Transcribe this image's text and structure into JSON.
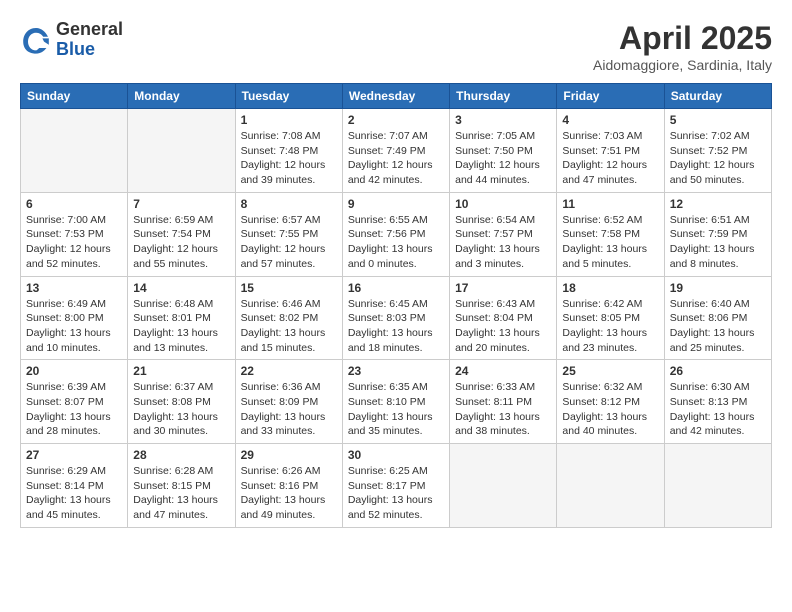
{
  "header": {
    "logo_general": "General",
    "logo_blue": "Blue",
    "month_title": "April 2025",
    "location": "Aidomaggiore, Sardinia, Italy"
  },
  "weekdays": [
    "Sunday",
    "Monday",
    "Tuesday",
    "Wednesday",
    "Thursday",
    "Friday",
    "Saturday"
  ],
  "weeks": [
    [
      {
        "day": "",
        "info": ""
      },
      {
        "day": "",
        "info": ""
      },
      {
        "day": "1",
        "info": "Sunrise: 7:08 AM\nSunset: 7:48 PM\nDaylight: 12 hours\nand 39 minutes."
      },
      {
        "day": "2",
        "info": "Sunrise: 7:07 AM\nSunset: 7:49 PM\nDaylight: 12 hours\nand 42 minutes."
      },
      {
        "day": "3",
        "info": "Sunrise: 7:05 AM\nSunset: 7:50 PM\nDaylight: 12 hours\nand 44 minutes."
      },
      {
        "day": "4",
        "info": "Sunrise: 7:03 AM\nSunset: 7:51 PM\nDaylight: 12 hours\nand 47 minutes."
      },
      {
        "day": "5",
        "info": "Sunrise: 7:02 AM\nSunset: 7:52 PM\nDaylight: 12 hours\nand 50 minutes."
      }
    ],
    [
      {
        "day": "6",
        "info": "Sunrise: 7:00 AM\nSunset: 7:53 PM\nDaylight: 12 hours\nand 52 minutes."
      },
      {
        "day": "7",
        "info": "Sunrise: 6:59 AM\nSunset: 7:54 PM\nDaylight: 12 hours\nand 55 minutes."
      },
      {
        "day": "8",
        "info": "Sunrise: 6:57 AM\nSunset: 7:55 PM\nDaylight: 12 hours\nand 57 minutes."
      },
      {
        "day": "9",
        "info": "Sunrise: 6:55 AM\nSunset: 7:56 PM\nDaylight: 13 hours\nand 0 minutes."
      },
      {
        "day": "10",
        "info": "Sunrise: 6:54 AM\nSunset: 7:57 PM\nDaylight: 13 hours\nand 3 minutes."
      },
      {
        "day": "11",
        "info": "Sunrise: 6:52 AM\nSunset: 7:58 PM\nDaylight: 13 hours\nand 5 minutes."
      },
      {
        "day": "12",
        "info": "Sunrise: 6:51 AM\nSunset: 7:59 PM\nDaylight: 13 hours\nand 8 minutes."
      }
    ],
    [
      {
        "day": "13",
        "info": "Sunrise: 6:49 AM\nSunset: 8:00 PM\nDaylight: 13 hours\nand 10 minutes."
      },
      {
        "day": "14",
        "info": "Sunrise: 6:48 AM\nSunset: 8:01 PM\nDaylight: 13 hours\nand 13 minutes."
      },
      {
        "day": "15",
        "info": "Sunrise: 6:46 AM\nSunset: 8:02 PM\nDaylight: 13 hours\nand 15 minutes."
      },
      {
        "day": "16",
        "info": "Sunrise: 6:45 AM\nSunset: 8:03 PM\nDaylight: 13 hours\nand 18 minutes."
      },
      {
        "day": "17",
        "info": "Sunrise: 6:43 AM\nSunset: 8:04 PM\nDaylight: 13 hours\nand 20 minutes."
      },
      {
        "day": "18",
        "info": "Sunrise: 6:42 AM\nSunset: 8:05 PM\nDaylight: 13 hours\nand 23 minutes."
      },
      {
        "day": "19",
        "info": "Sunrise: 6:40 AM\nSunset: 8:06 PM\nDaylight: 13 hours\nand 25 minutes."
      }
    ],
    [
      {
        "day": "20",
        "info": "Sunrise: 6:39 AM\nSunset: 8:07 PM\nDaylight: 13 hours\nand 28 minutes."
      },
      {
        "day": "21",
        "info": "Sunrise: 6:37 AM\nSunset: 8:08 PM\nDaylight: 13 hours\nand 30 minutes."
      },
      {
        "day": "22",
        "info": "Sunrise: 6:36 AM\nSunset: 8:09 PM\nDaylight: 13 hours\nand 33 minutes."
      },
      {
        "day": "23",
        "info": "Sunrise: 6:35 AM\nSunset: 8:10 PM\nDaylight: 13 hours\nand 35 minutes."
      },
      {
        "day": "24",
        "info": "Sunrise: 6:33 AM\nSunset: 8:11 PM\nDaylight: 13 hours\nand 38 minutes."
      },
      {
        "day": "25",
        "info": "Sunrise: 6:32 AM\nSunset: 8:12 PM\nDaylight: 13 hours\nand 40 minutes."
      },
      {
        "day": "26",
        "info": "Sunrise: 6:30 AM\nSunset: 8:13 PM\nDaylight: 13 hours\nand 42 minutes."
      }
    ],
    [
      {
        "day": "27",
        "info": "Sunrise: 6:29 AM\nSunset: 8:14 PM\nDaylight: 13 hours\nand 45 minutes."
      },
      {
        "day": "28",
        "info": "Sunrise: 6:28 AM\nSunset: 8:15 PM\nDaylight: 13 hours\nand 47 minutes."
      },
      {
        "day": "29",
        "info": "Sunrise: 6:26 AM\nSunset: 8:16 PM\nDaylight: 13 hours\nand 49 minutes."
      },
      {
        "day": "30",
        "info": "Sunrise: 6:25 AM\nSunset: 8:17 PM\nDaylight: 13 hours\nand 52 minutes."
      },
      {
        "day": "",
        "info": ""
      },
      {
        "day": "",
        "info": ""
      },
      {
        "day": "",
        "info": ""
      }
    ]
  ]
}
